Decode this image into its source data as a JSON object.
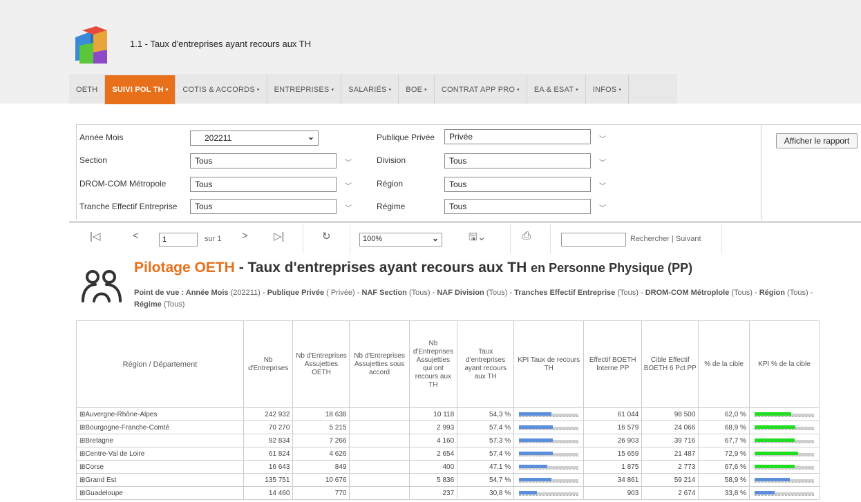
{
  "app": {
    "title": "1.1 - Taux d'entreprises ayant recours aux TH"
  },
  "nav": [
    {
      "label": "OETH",
      "active": false,
      "caret": ""
    },
    {
      "label": "SUIVI POL TH",
      "active": true,
      "caret": "▾"
    },
    {
      "label": "COTIS & ACCORDS",
      "active": false,
      "caret": "▾"
    },
    {
      "label": "ENTREPRISES",
      "active": false,
      "caret": "▾"
    },
    {
      "label": "SALARIÉS",
      "active": false,
      "caret": "▾"
    },
    {
      "label": "BOE",
      "active": false,
      "caret": "▾"
    },
    {
      "label": "CONTRAT APP PRO",
      "active": false,
      "caret": "▾"
    },
    {
      "label": "EA & ESAT",
      "active": false,
      "caret": "▾"
    },
    {
      "label": "INFOS",
      "active": false,
      "caret": "▾"
    }
  ],
  "filters": {
    "annee_mois": {
      "label": "Année Mois",
      "value": "202211"
    },
    "section": {
      "label": "Section",
      "value": "Tous"
    },
    "dromcom": {
      "label": "DROM-COM Métropole",
      "value": "Tous"
    },
    "tranche": {
      "label": "Tranche Effectif Entreprise",
      "value": "Tous"
    },
    "publique": {
      "label": "Publique Privée",
      "value": "Privée"
    },
    "division": {
      "label": "Division",
      "value": "Tous"
    },
    "region": {
      "label": "Région",
      "value": "Tous"
    },
    "regime": {
      "label": "Régime",
      "value": "Tous"
    },
    "run_label": "Afficher le rapport"
  },
  "toolbar": {
    "page": "1",
    "page_of": "sur 1",
    "zoom": "100%",
    "find_links": "Rechercher | Suivant",
    "search_value": ""
  },
  "report": {
    "title_part1": "Pilotage OETH",
    "title_part2": " - Taux d'entreprises ayant recours aux TH ",
    "title_part3": "en Personne Physique (PP)",
    "pov": {
      "k1": "Point de vue : Année Mois",
      "v1": " (202211) - ",
      "k2": "Publique Privée",
      "v2": " (  Privée) - ",
      "k3": "NAF Section",
      "v3": " (Tous) - ",
      "k4": "NAF Division",
      "v4": " (Tous) - ",
      "k5": "Tranches Effectif Entreprise",
      "v5": " (Tous) - ",
      "k6": "DROM-COM Métroplole",
      "v6": " (Tous) - ",
      "k7": "Région",
      "v7": " (Tous) - ",
      "k8": "Régime",
      "v8": " (Tous)"
    }
  },
  "table": {
    "headers": [
      "Région / Département",
      "Nb d'Entreprises",
      "Nb d'Entreprises Assujetties OETH",
      "Nb d'Entreprises Assujetties sous accord",
      "Nb d'Entreprises Assujetties qui ont recours aux TH",
      "Taux d'entreprises ayant recours aux TH",
      "KPI Taux de recours TH",
      "Effectif BOETH Interne PP",
      "Cible Effectif BOETH 6 Pct PP",
      "% de la cible",
      "KPI % de la cible"
    ],
    "rows": [
      {
        "region": "⊞Auvergne-Rhône-Alpes",
        "nb": "242 932",
        "assuj": "18 638",
        "accord": "",
        "recours": "10 118",
        "taux": "54,3 %",
        "taux_kpi": 0.543,
        "effectif": "61 044",
        "cible": "98 500",
        "pct_cible": "62,0 %",
        "cible_kpi": 0.62,
        "cible_color": "#22dd22"
      },
      {
        "region": "⊞Bourgogne-Franche-Comté",
        "nb": "70 270",
        "assuj": "5 215",
        "accord": "",
        "recours": "2 993",
        "taux": "57,4 %",
        "taux_kpi": 0.574,
        "effectif": "16 579",
        "cible": "24 066",
        "pct_cible": "68,9 %",
        "cible_kpi": 0.689,
        "cible_color": "#22dd22"
      },
      {
        "region": "⊞Bretagne",
        "nb": "92 834",
        "assuj": "7 266",
        "accord": "",
        "recours": "4 160",
        "taux": "57,3 %",
        "taux_kpi": 0.573,
        "effectif": "26 903",
        "cible": "39 716",
        "pct_cible": "67,7 %",
        "cible_kpi": 0.677,
        "cible_color": "#22dd22"
      },
      {
        "region": "⊞Centre-Val de Loire",
        "nb": "61 824",
        "assuj": "4 626",
        "accord": "",
        "recours": "2 654",
        "taux": "57,4 %",
        "taux_kpi": 0.574,
        "effectif": "15 659",
        "cible": "21 487",
        "pct_cible": "72,9 %",
        "cible_kpi": 0.729,
        "cible_color": "#22dd22"
      },
      {
        "region": "⊞Corse",
        "nb": "16 643",
        "assuj": "849",
        "accord": "",
        "recours": "400",
        "taux": "47,1 %",
        "taux_kpi": 0.471,
        "effectif": "1 875",
        "cible": "2 773",
        "pct_cible": "67,6 %",
        "cible_kpi": 0.676,
        "cible_color": "#22dd22"
      },
      {
        "region": "⊞Grand Est",
        "nb": "135 751",
        "assuj": "10 676",
        "accord": "",
        "recours": "5 836",
        "taux": "54,7 %",
        "taux_kpi": 0.547,
        "effectif": "34 861",
        "cible": "59 214",
        "pct_cible": "58,9 %",
        "cible_kpi": 0.589,
        "cible_color": "#5b8fdc"
      },
      {
        "region": "⊞Guadeloupe",
        "nb": "14 460",
        "assuj": "770",
        "accord": "",
        "recours": "237",
        "taux": "30,8 %",
        "taux_kpi": 0.308,
        "effectif": "903",
        "cible": "2 674",
        "pct_cible": "33,8 %",
        "cible_kpi": 0.338,
        "cible_color": "#5b8fdc"
      }
    ]
  },
  "colors": {
    "accent": "#e8701a",
    "kpi_blue": "#5b8fdc",
    "kpi_green": "#22dd22"
  }
}
